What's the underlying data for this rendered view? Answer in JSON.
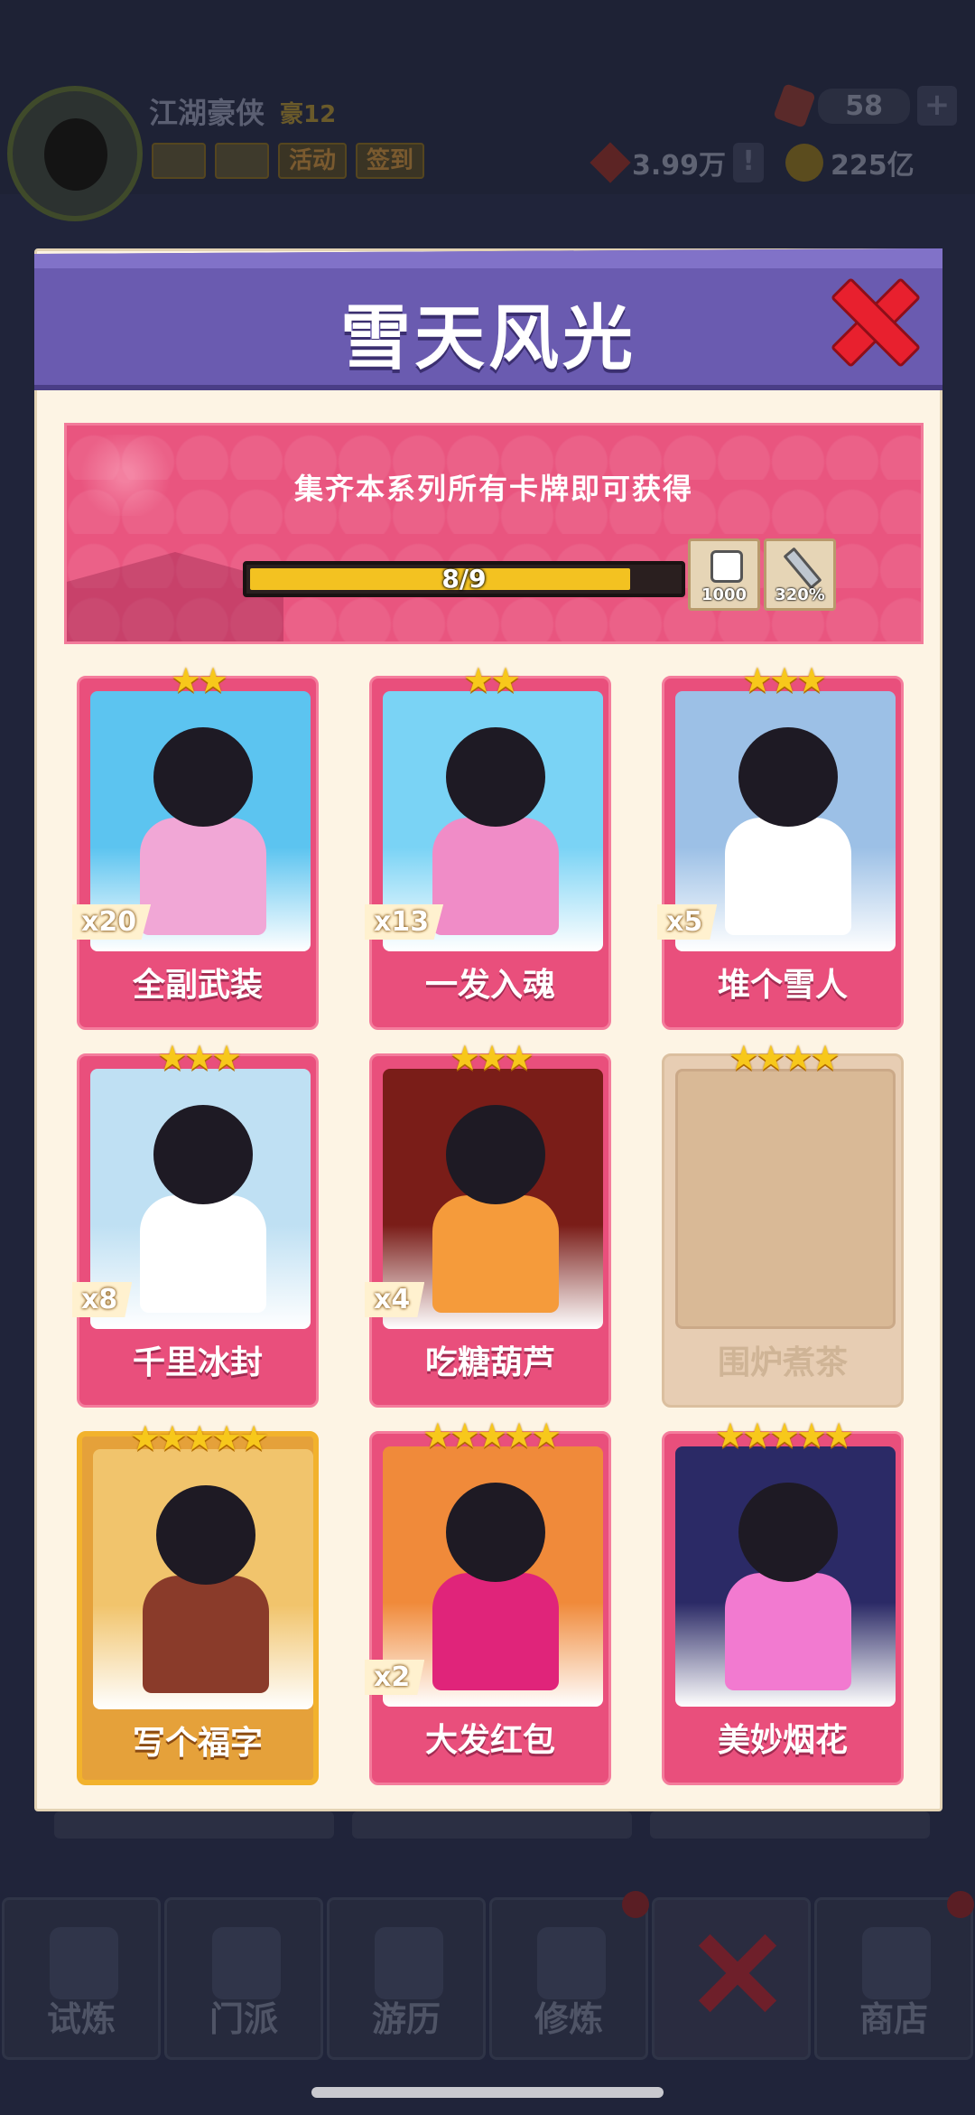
{
  "header": {
    "player_name": "江湖豪侠",
    "player_rank": "豪12",
    "buttons": [
      "活动",
      "签到"
    ],
    "gems": "58",
    "red_currency": "3.99万",
    "coins": "225亿"
  },
  "modal": {
    "title": "雪天风光",
    "banner_text": "集齐本系列所有卡牌即可获得",
    "progress_text": "8/9",
    "progress_fraction": 0.889,
    "rewards": [
      {
        "icon": "dice-icon",
        "value": "1000"
      },
      {
        "icon": "sword-icon",
        "value": "320%"
      }
    ]
  },
  "cards": [
    {
      "name": "全副武装",
      "stars": "★★",
      "count": "x20",
      "art_color": "#5cc4f0",
      "accent": "#f1a7d6"
    },
    {
      "name": "一发入魂",
      "stars": "★★",
      "count": "x13",
      "art_color": "#7ad3f5",
      "accent": "#f08cc7"
    },
    {
      "name": "堆个雪人",
      "stars": "★★★",
      "count": "x5",
      "art_color": "#9cc0e6",
      "accent": "#ffffff"
    },
    {
      "name": "千里冰封",
      "stars": "★★★",
      "count": "x8",
      "art_color": "#bfe0f3",
      "accent": "#ffffff"
    },
    {
      "name": "吃糖葫芦",
      "stars": "★★★",
      "count": "x4",
      "art_color": "#7a1d18",
      "accent": "#f59b3b"
    },
    {
      "name": "围炉煮茶",
      "stars": "★★★★",
      "count": "",
      "art_color": "#d9b996",
      "accent": "#d9b996"
    },
    {
      "name": "写个福字",
      "stars": "★★★★★",
      "count": "",
      "art_color": "#f1c46c",
      "accent": "#8a3b2a"
    },
    {
      "name": "大发红包",
      "stars": "★★★★★",
      "count": "x2",
      "art_color": "#f08a3a",
      "accent": "#e0247a"
    },
    {
      "name": "美妙烟花",
      "stars": "★★★★★",
      "count": "",
      "art_color": "#2b2a66",
      "accent": "#f27ad0"
    }
  ],
  "nav": {
    "items": [
      "试炼",
      "门派",
      "游历",
      "修炼",
      "",
      "商店"
    ]
  }
}
